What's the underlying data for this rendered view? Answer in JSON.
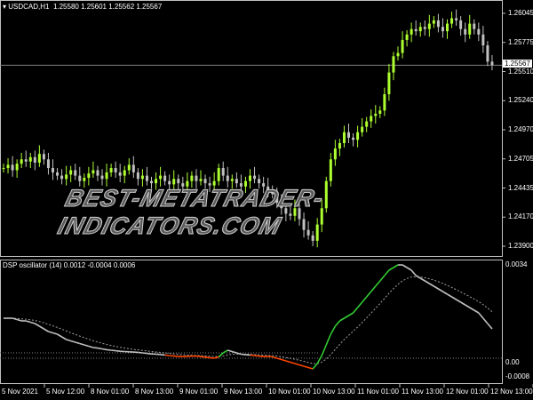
{
  "header": {
    "symbol": "USDCAD,H1",
    "ohlc": "1.25580 1.25601 1.25562 1.25567"
  },
  "indicator": {
    "title": "DSP oscillator (14) 0.0012 -0.0004 0.0006"
  },
  "watermark": "BEST-METATRADER-INDICATORS.COM",
  "current_price": "1.25567",
  "colors": {
    "bull": "#adff2f",
    "bear": "#c0c0c0",
    "up": "#32cd32",
    "down": "#ff4500",
    "neutral": "#c0c0c0"
  },
  "price_axis": [
    "1.26045",
    "1.25775",
    "1.25510",
    "1.25240",
    "1.24970",
    "1.24705",
    "1.24435",
    "1.24170",
    "1.23900"
  ],
  "osc_axis": [
    "0.0034",
    "0.00",
    "-0.0008"
  ],
  "time_axis": [
    "5 Nov 2021",
    "5 Nov 12:00",
    "8 Nov 01:00",
    "8 Nov 13:00",
    "9 Nov 01:00",
    "9 Nov 13:00",
    "10 Nov 01:00",
    "10 Nov 13:00",
    "11 Nov 01:00",
    "11 Nov 13:00",
    "12 Nov 01:00",
    "12 Nov 13:00"
  ],
  "chart_data": {
    "type": "candlestick",
    "price_range": [
      1.239,
      1.26045
    ],
    "closes": [
      1.2462,
      1.2465,
      1.246,
      1.2466,
      1.247,
      1.2468,
      1.2472,
      1.2467,
      1.2475,
      1.247,
      1.2462,
      1.2458,
      1.2455,
      1.2452,
      1.2456,
      1.246,
      1.2455,
      1.245,
      1.2453,
      1.2457,
      1.246,
      1.2455,
      1.2452,
      1.2458,
      1.2462,
      1.2458,
      1.2455,
      1.246,
      1.2465,
      1.2458,
      1.2452,
      1.2455,
      1.245,
      1.2448,
      1.2452,
      1.2455,
      1.245,
      1.2447,
      1.2452,
      1.2448,
      1.2445,
      1.245,
      1.2455,
      1.245,
      1.2452,
      1.2448,
      1.2446,
      1.245,
      1.2462,
      1.2455,
      1.245,
      1.2452,
      1.2448,
      1.2445,
      1.245,
      1.2455,
      1.2452,
      1.2448,
      1.2445,
      1.2442,
      1.2438,
      1.243,
      1.2425,
      1.242,
      1.2418,
      1.2425,
      1.2415,
      1.2405,
      1.24,
      1.2395,
      1.241,
      1.2425,
      1.245,
      1.247,
      1.248,
      1.2485,
      1.2495,
      1.249,
      1.2488,
      1.2495,
      1.25,
      1.2505,
      1.251,
      1.2512,
      1.2515,
      1.253,
      1.255,
      1.2565,
      1.2568,
      1.258,
      1.2585,
      1.259,
      1.2588,
      1.2592,
      1.259,
      1.2595,
      1.2598,
      1.2592,
      1.2588,
      1.2595,
      1.26,
      1.2598,
      1.259,
      1.2585,
      1.2595,
      1.259,
      1.2585,
      1.2575,
      1.256,
      1.2557
    ],
    "osc_range": [
      -0.0008,
      0.0034
    ],
    "osc_main_e4": [
      14,
      14,
      14,
      13.5,
      13,
      13,
      12.5,
      12,
      11,
      10,
      9,
      8.5,
      8,
      7,
      6,
      5.5,
      5,
      4.5,
      4,
      3.5,
      3,
      2.8,
      2.5,
      2.2,
      2,
      1.8,
      1.6,
      1.5,
      1.4,
      1.3,
      1.2,
      1,
      0.8,
      0.6,
      0.5,
      0.4,
      0.2,
      0,
      -0.2,
      -0.3,
      -0.4,
      -0.3,
      -0.2,
      -0.2,
      -0.4,
      -0.6,
      -0.8,
      -1,
      -0.5,
      1,
      2,
      1.5,
      1,
      0.5,
      0.3,
      0.2,
      0,
      -0.2,
      -0.4,
      -0.3,
      -0.5,
      -1,
      -1.5,
      -2,
      -2.5,
      -3,
      -3.5,
      -4,
      -4.5,
      -5,
      -3,
      0,
      4,
      8,
      11,
      13,
      14,
      15,
      16,
      18,
      20,
      22,
      24,
      26,
      28,
      30,
      32,
      33,
      34,
      34,
      33,
      32,
      30,
      29,
      28,
      27,
      26,
      25,
      24,
      23,
      22,
      21,
      20,
      19,
      18,
      17,
      16,
      14,
      12,
      10
    ]
  }
}
